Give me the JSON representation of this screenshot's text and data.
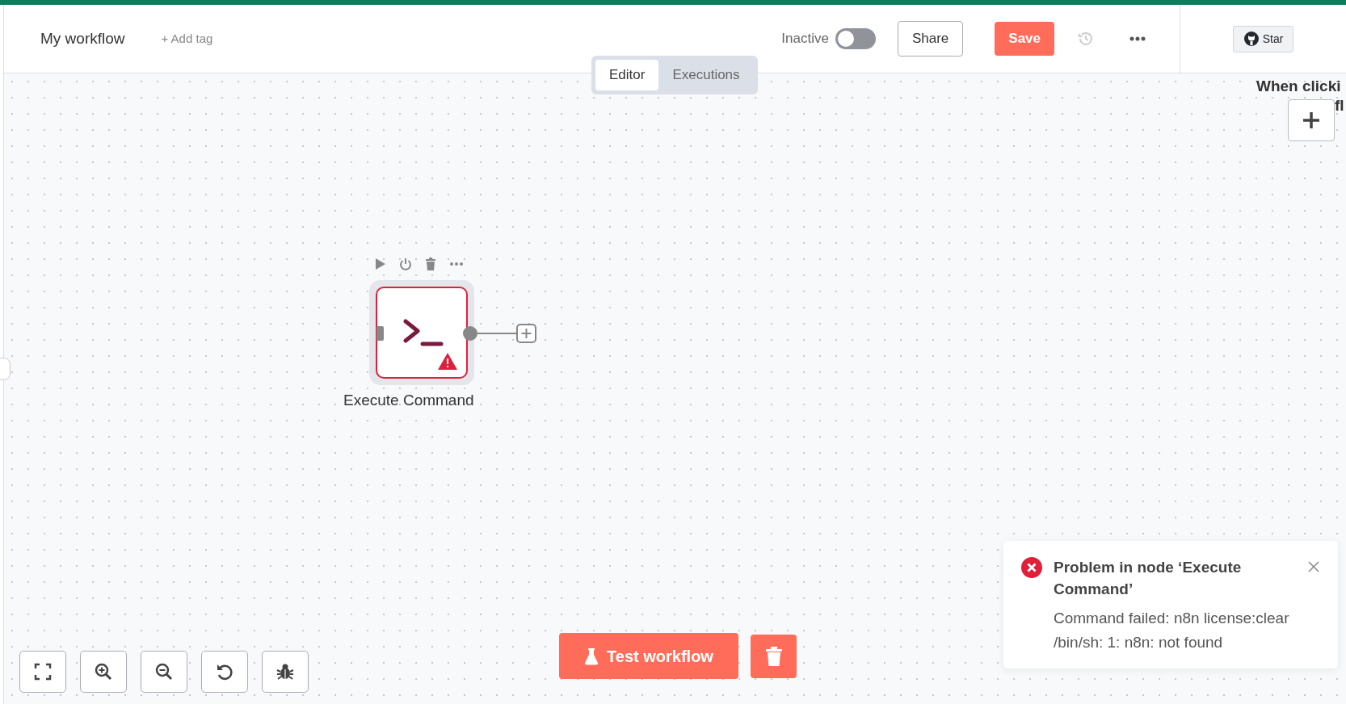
{
  "top_bar": {
    "workflow_name": "My workflow",
    "add_tag": "+ Add tag",
    "active_label": "Inactive",
    "active": false,
    "share": "Share",
    "save": "Save",
    "star": "Star"
  },
  "view_tabs": [
    {
      "label": "Editor",
      "selected": true
    },
    {
      "label": "Executions",
      "selected": false
    }
  ],
  "canvas": {
    "node": {
      "name": "Execute Command",
      "has_error": true
    },
    "trigger_label_lines": [
      "When clicki",
      "fl"
    ]
  },
  "toast": {
    "title": "Problem in node ‘Execute Command’",
    "message": "Command failed: n8n license:clear /bin/sh: 1: n8n: not found"
  },
  "test_button": "Test workflow"
}
